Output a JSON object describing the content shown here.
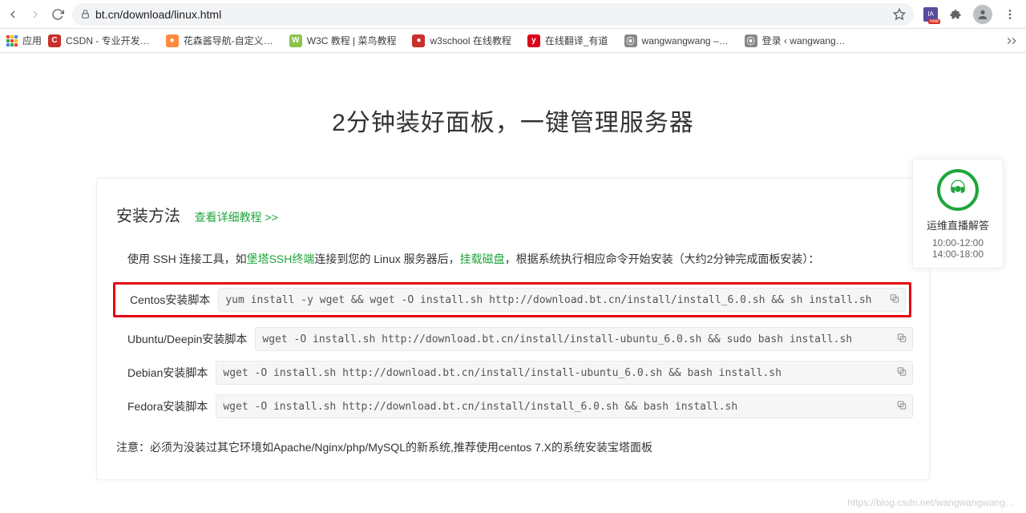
{
  "toolbar": {
    "url": "bt.cn/download/linux.html"
  },
  "bookmarks": {
    "apps_label": "应用",
    "items": [
      {
        "label": "CSDN - 专业开发…",
        "bg": "#c9302c",
        "glyph": "C"
      },
      {
        "label": "花森酱导航-自定义…",
        "bg": "#ff8a3d",
        "glyph": "●"
      },
      {
        "label": "W3C 教程 | 菜鸟教程",
        "bg": "#8bc34a",
        "glyph": "W"
      },
      {
        "label": "w3school 在线教程",
        "bg": "#c9302c",
        "glyph": "●"
      },
      {
        "label": "在线翻译_有道",
        "bg": "#d9001b",
        "glyph": "y"
      },
      {
        "label": "wangwangwang –…",
        "bg": "#888",
        "glyph": "⦿"
      },
      {
        "label": "登录 ‹ wangwang…",
        "bg": "#888",
        "glyph": "⦿"
      }
    ]
  },
  "page": {
    "hero": "2分钟装好面板，一键管理服务器",
    "section_title": "安装方法",
    "detail_link": "查看详细教程 >>",
    "intro_pre": "使用 SSH 连接工具，如",
    "intro_link1": "堡塔SSH终端",
    "intro_mid": "连接到您的 Linux 服务器后，",
    "intro_link2": "挂载磁盘",
    "intro_post": "，根据系统执行相应命令开始安装（大约2分钟完成面板安装）：",
    "scripts": [
      {
        "label": "Centos安装脚本",
        "cmd": "yum install -y wget && wget -O install.sh http://download.bt.cn/install/install_6.0.sh && sh install.sh",
        "highlight": true
      },
      {
        "label": "Ubuntu/Deepin安装脚本",
        "cmd": "wget -O install.sh http://download.bt.cn/install/install-ubuntu_6.0.sh && sudo bash install.sh",
        "highlight": false
      },
      {
        "label": "Debian安装脚本",
        "cmd": "wget -O install.sh http://download.bt.cn/install/install-ubuntu_6.0.sh && bash install.sh",
        "highlight": false
      },
      {
        "label": "Fedora安装脚本",
        "cmd": "wget -O install.sh http://download.bt.cn/install/install_6.0.sh && bash install.sh",
        "highlight": false
      }
    ],
    "note": "注意：必须为没装过其它环境如Apache/Nginx/php/MySQL的新系统,推荐使用centos 7.X的系统安装宝塔面板"
  },
  "float": {
    "title": "运维直播解答",
    "line1": "10:00-12:00",
    "line2": "14:00-18:00"
  },
  "watermark": "https://blog.csdn.net/wangwangwang…"
}
